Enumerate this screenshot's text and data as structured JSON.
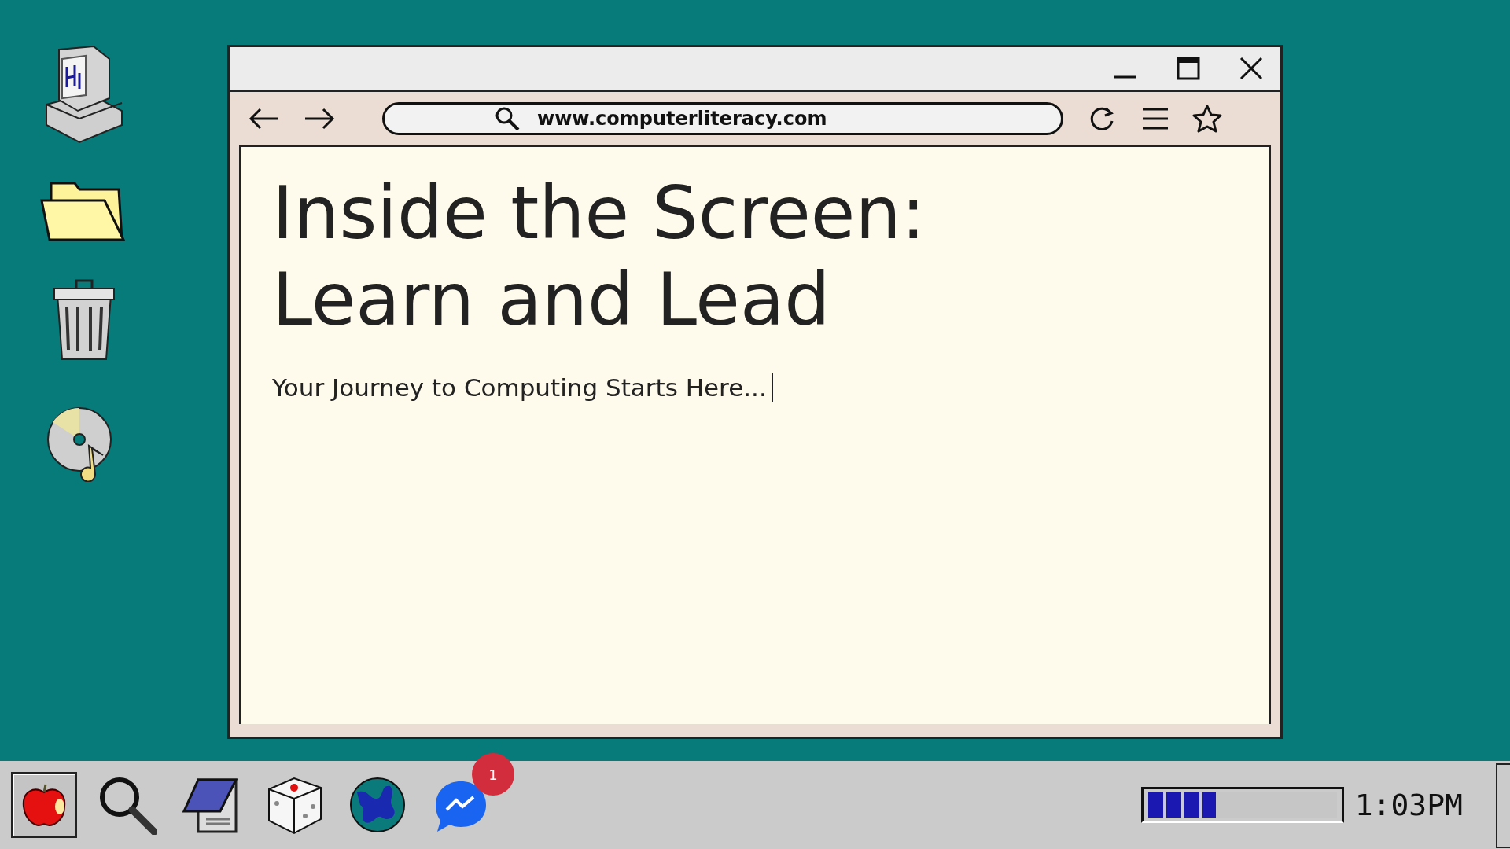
{
  "browser": {
    "url": "www.computerliteracy.com",
    "heading_lines": [
      "Inside the Screen:",
      "Learn and Lead"
    ],
    "subtitle": "Your Journey to Computing Starts Here..."
  },
  "taskbar": {
    "apps": [
      {
        "selected": true
      },
      {
        "selected": false
      },
      {
        "selected": false
      },
      {
        "selected": false
      },
      {
        "selected": false
      },
      {
        "selected": false
      }
    ],
    "badge": "1",
    "progress": {
      "level": 0.36
    },
    "clock": "1:03PM"
  }
}
